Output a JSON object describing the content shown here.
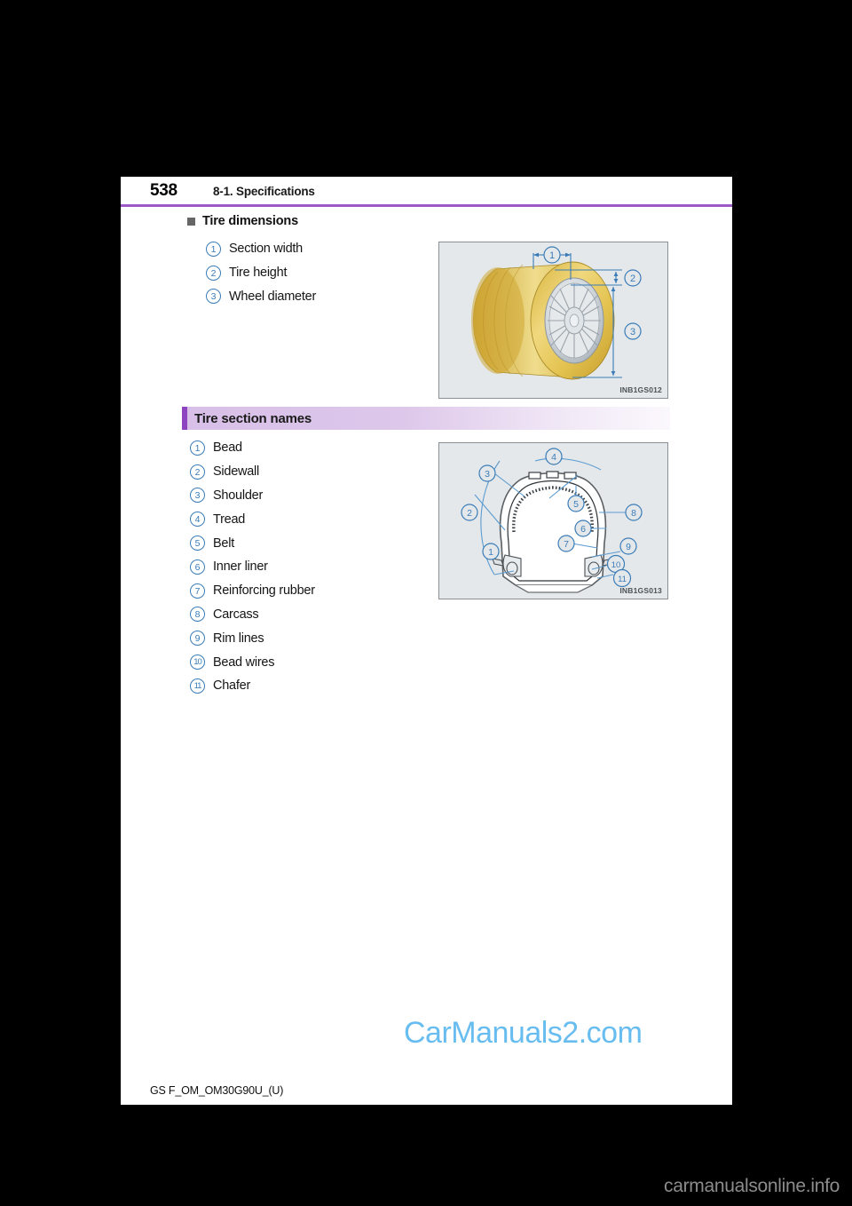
{
  "document": {
    "page_number": "538",
    "section_title": "8-1. Specifications",
    "footer_code": "GS F_OM_OM30G90U_(U)",
    "accent_color": "#9b59c8",
    "number_badge_color": "#3a7cb8"
  },
  "watermarks": {
    "main": "CarManuals2.com",
    "main_color": "#68bdf0",
    "corner": "carmanualsonline.info",
    "corner_color": "#8c8c8c"
  },
  "tire_dimensions": {
    "heading": "Tire dimensions",
    "items": [
      {
        "num": "1",
        "label": "Section width"
      },
      {
        "num": "2",
        "label": "Tire height"
      },
      {
        "num": "3",
        "label": "Wheel diameter"
      }
    ],
    "figure": {
      "code": "INB1GS012",
      "alt": "Perspective view of a tire mounted on a multi-spoke alloy wheel with dimension callouts",
      "callouts": [
        "1",
        "2",
        "3"
      ]
    }
  },
  "tire_section_names": {
    "heading": "Tire section names",
    "items": [
      {
        "num": "1",
        "label": "Bead"
      },
      {
        "num": "2",
        "label": "Sidewall"
      },
      {
        "num": "3",
        "label": "Shoulder"
      },
      {
        "num": "4",
        "label": "Tread"
      },
      {
        "num": "5",
        "label": "Belt"
      },
      {
        "num": "6",
        "label": "Inner liner"
      },
      {
        "num": "7",
        "label": "Reinforcing rubber"
      },
      {
        "num": "8",
        "label": "Carcass"
      },
      {
        "num": "9",
        "label": "Rim lines"
      },
      {
        "num": "10",
        "label": "Bead wires"
      },
      {
        "num": "11",
        "label": "Chafer"
      }
    ],
    "figure": {
      "code": "INB1GS013",
      "alt": "Cross-section cutaway diagram of a tire with eleven numbered part callouts",
      "callouts": [
        "1",
        "2",
        "3",
        "4",
        "5",
        "6",
        "7",
        "8",
        "9",
        "10",
        "11"
      ]
    }
  }
}
